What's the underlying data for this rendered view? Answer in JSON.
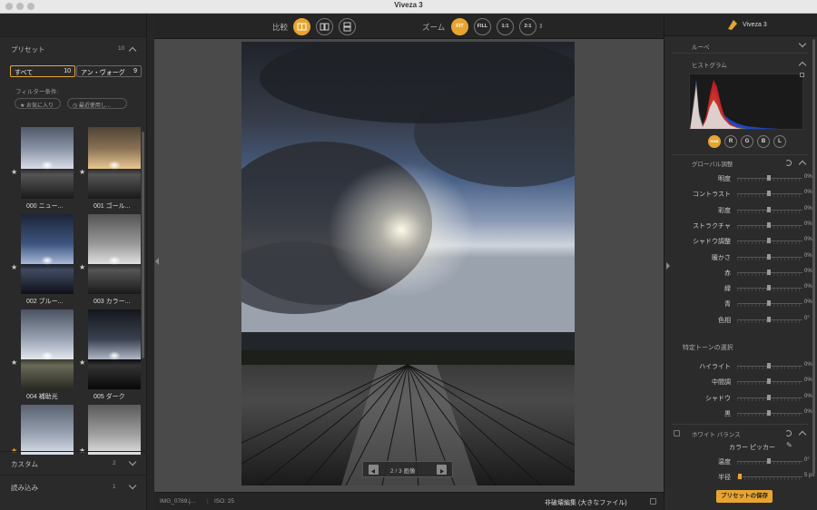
{
  "window": {
    "title": "Viveza 3"
  },
  "left_panel": {
    "presets_title": "プリセット",
    "presets_count": "10",
    "filter_all_label": "すべて",
    "filter_all_count": "10",
    "filter_vogue_label": "アン・ヴォーグ",
    "filter_vogue_count": "9",
    "filter_condition_label": "フィルター条件:",
    "filter_favorites": "お気に入り",
    "filter_recent": "最近使用し...",
    "thumbnails": [
      {
        "label": "000 ニュー...",
        "starred": true,
        "gold": false
      },
      {
        "label": "001 ゴール...",
        "starred": true,
        "gold": false
      },
      {
        "label": "002 ブルー...",
        "starred": true,
        "gold": false
      },
      {
        "label": "003 カラー...",
        "starred": true,
        "gold": false
      },
      {
        "label": "004 補助光",
        "starred": true,
        "gold": false
      },
      {
        "label": "005 ダーク",
        "starred": true,
        "gold": false
      },
      {
        "label": "",
        "starred": true,
        "gold": true
      },
      {
        "label": "",
        "starred": true,
        "gold": false
      }
    ],
    "custom_label": "カスタム",
    "custom_count": "2",
    "import_label": "読み込み",
    "import_count": "1"
  },
  "toolbar": {
    "compare_label": "比較",
    "zoom_label": "ズーム",
    "zoom_fit": "FIT",
    "zoom_fill": "FILL",
    "zoom_1_1": "1:1",
    "zoom_2_1": "2:1"
  },
  "navigator": {
    "text": "2 / 3 画像"
  },
  "statusbar": {
    "filename": "IMG_0789.j...",
    "iso": "ISO: 25",
    "nondestructive": "非破壊編集 (大きなファイル)"
  },
  "right_panel": {
    "brand": "Viveza 3",
    "loupe": "ルーペ",
    "histogram": "ヒストグラム",
    "channels": [
      "RGB",
      "R",
      "G",
      "B",
      "L"
    ],
    "global_title": "グローバル調整",
    "global_sliders": [
      {
        "label": "明度",
        "value": "0%"
      },
      {
        "label": "コントラスト",
        "value": "0%"
      },
      {
        "label": "彩度",
        "value": "0%"
      },
      {
        "label": "ストラクチャ",
        "value": "0%"
      },
      {
        "label": "シャドウ調整",
        "value": "0%"
      },
      {
        "label": "暖かさ",
        "value": "0%"
      },
      {
        "label": "赤",
        "value": "0%"
      },
      {
        "label": "緑",
        "value": "0%"
      },
      {
        "label": "青",
        "value": "0%"
      },
      {
        "label": "色相",
        "value": "0°"
      }
    ],
    "tone_title": "特定トーンの選択",
    "tone_sliders": [
      {
        "label": "ハイライト",
        "value": "0%"
      },
      {
        "label": "中間調",
        "value": "0%"
      },
      {
        "label": "シャドウ",
        "value": "0%"
      },
      {
        "label": "黒",
        "value": "0%"
      }
    ],
    "wb_title": "ホワイト バランス",
    "color_picker": "カラー ピッカー",
    "temp_label": "温度",
    "temp_value": "0°",
    "radius_label": "半径",
    "radius_value": "5 px",
    "save_preset": "プリセットの保存"
  }
}
